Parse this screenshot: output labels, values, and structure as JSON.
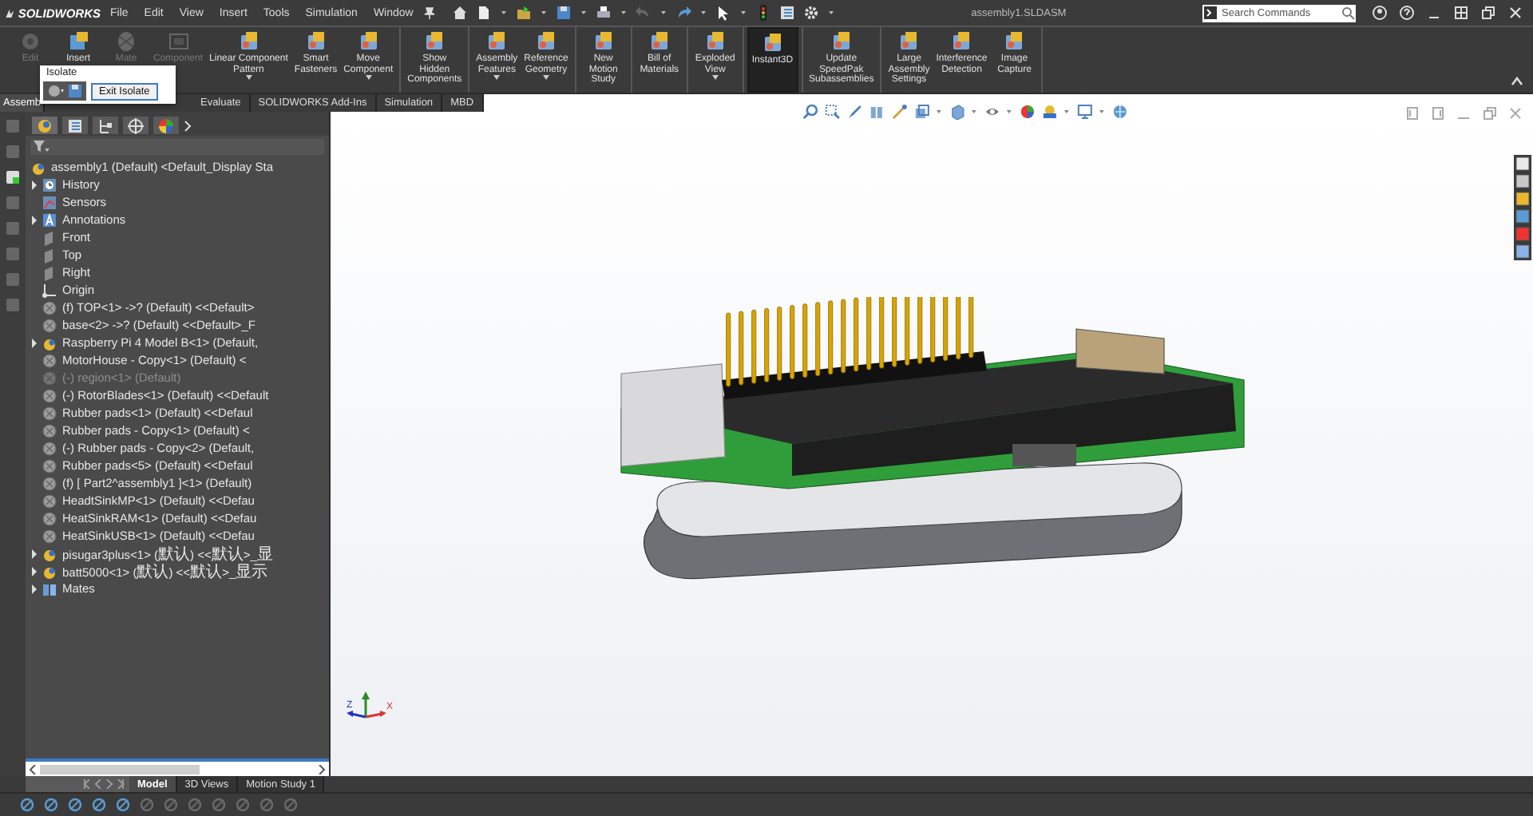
{
  "titlebar": {
    "brand": "SOLIDWORKS",
    "menus": [
      "File",
      "Edit",
      "View",
      "Insert",
      "Tools",
      "Simulation",
      "Window"
    ],
    "document_title": "assembly1.SLDASM",
    "search": {
      "placeholder": "Search Commands"
    }
  },
  "ribbon": {
    "groups": [
      [
        {
          "label": "Edit",
          "disabled": true,
          "on": false,
          "dropdown": false
        },
        {
          "label": "Insert",
          "disabled": false,
          "on": false,
          "dropdown": false
        },
        {
          "label": "Mate",
          "disabled": true,
          "on": false,
          "dropdown": false
        },
        {
          "label": "Component",
          "disabled": true,
          "on": false,
          "dropdown": false
        },
        {
          "label": "Linear Component\nPattern",
          "disabled": false,
          "on": false,
          "dropdown": true
        },
        {
          "label": "Smart\nFasteners",
          "disabled": false,
          "on": false,
          "dropdown": false
        },
        {
          "label": "Move\nComponent",
          "disabled": false,
          "on": false,
          "dropdown": true
        }
      ],
      [
        {
          "label": "Show\nHidden\nComponents",
          "disabled": false,
          "on": false,
          "dropdown": false
        }
      ],
      [
        {
          "label": "Assembly\nFeatures",
          "disabled": false,
          "on": false,
          "dropdown": true
        },
        {
          "label": "Reference\nGeometry",
          "disabled": false,
          "on": false,
          "dropdown": true
        }
      ],
      [
        {
          "label": "New\nMotion\nStudy",
          "disabled": false,
          "on": false,
          "dropdown": false
        }
      ],
      [
        {
          "label": "Bill of\nMaterials",
          "disabled": false,
          "on": false,
          "dropdown": false
        }
      ],
      [
        {
          "label": "Exploded\nView",
          "disabled": false,
          "on": false,
          "dropdown": true
        }
      ],
      [
        {
          "label": "Instant3D",
          "disabled": false,
          "on": true,
          "dropdown": false
        }
      ],
      [
        {
          "label": "Update\nSpeedPak\nSubassemblies",
          "disabled": false,
          "on": false,
          "dropdown": false
        }
      ],
      [
        {
          "label": "Large\nAssembly\nSettings",
          "disabled": false,
          "on": false,
          "dropdown": false
        },
        {
          "label": "Interference\nDetection",
          "disabled": false,
          "on": false,
          "dropdown": false
        },
        {
          "label": "Image\nCapture",
          "disabled": false,
          "on": false,
          "dropdown": false
        }
      ]
    ]
  },
  "tabs": [
    {
      "label": "Assemb",
      "selected": true
    },
    {
      "label": "Evaluate",
      "selected": false
    },
    {
      "label": "SOLIDWORKS Add-Ins",
      "selected": false
    },
    {
      "label": "Simulation",
      "selected": false
    },
    {
      "label": "MBD",
      "selected": false
    }
  ],
  "isolate_popup": {
    "title": "Isolate",
    "button": "Exit Isolate"
  },
  "tree": {
    "root": {
      "label": "assembly1 (Default) <Default_Display Sta",
      "kind": "assembly",
      "children": [
        {
          "label": "History",
          "kind": "history",
          "collapsed": true,
          "suppressed": false
        },
        {
          "label": "Sensors",
          "kind": "sensor",
          "collapsed": false,
          "suppressed": false
        },
        {
          "label": "Annotations",
          "kind": "annotation",
          "collapsed": true,
          "suppressed": false
        },
        {
          "label": "Front",
          "kind": "plane",
          "collapsed": false,
          "suppressed": false
        },
        {
          "label": "Top",
          "kind": "plane",
          "collapsed": false,
          "suppressed": false
        },
        {
          "label": "Right",
          "kind": "plane",
          "collapsed": false,
          "suppressed": false
        },
        {
          "label": "Origin",
          "kind": "origin",
          "collapsed": false,
          "suppressed": false
        },
        {
          "label": "(f) TOP<1> ->? (Default) <<Default>",
          "kind": "part",
          "collapsed": false,
          "suppressed": false
        },
        {
          "label": "base<2> ->? (Default) <<Default>_F",
          "kind": "part",
          "collapsed": false,
          "suppressed": false
        },
        {
          "label": "Raspberry Pi 4 Model B<1> (Default,",
          "kind": "assembly",
          "collapsed": true,
          "suppressed": false
        },
        {
          "label": "MotorHouse - Copy<1> (Default) <",
          "kind": "part",
          "collapsed": false,
          "suppressed": false
        },
        {
          "label": "(-) region<1> (Default)",
          "kind": "part",
          "collapsed": false,
          "suppressed": true
        },
        {
          "label": "(-) RotorBlades<1> (Default) <<Default",
          "kind": "part",
          "collapsed": false,
          "suppressed": false
        },
        {
          "label": "Rubber pads<1> (Default) <<Defaul",
          "kind": "part",
          "collapsed": false,
          "suppressed": false
        },
        {
          "label": "Rubber pads - Copy<1> (Default) <",
          "kind": "part",
          "collapsed": false,
          "suppressed": false
        },
        {
          "label": "(-) Rubber pads - Copy<2> (Default,",
          "kind": "part",
          "collapsed": false,
          "suppressed": false
        },
        {
          "label": "Rubber pads<5> (Default) <<Defaul",
          "kind": "part",
          "collapsed": false,
          "suppressed": false
        },
        {
          "label": "(f) [ Part2^assembly1 ]<1> (Default)",
          "kind": "part",
          "collapsed": false,
          "suppressed": false
        },
        {
          "label": "HeadtSinkMP<1> (Default) <<Defau",
          "kind": "part",
          "collapsed": false,
          "suppressed": false
        },
        {
          "label": "HeatSinkRAM<1> (Default) <<Defau",
          "kind": "part",
          "collapsed": false,
          "suppressed": false
        },
        {
          "label": "HeatSinkUSB<1> (Default) <<Defau",
          "kind": "part",
          "collapsed": false,
          "suppressed": false
        },
        {
          "label": "pisugar3plus<1> (默认) <<默认>_显",
          "kind": "assembly",
          "collapsed": true,
          "suppressed": false
        },
        {
          "label": "batt5000<1> (默认) <<默认>_显示",
          "kind": "assembly",
          "collapsed": true,
          "suppressed": false
        },
        {
          "label": "Mates",
          "kind": "mates",
          "collapsed": true,
          "suppressed": false
        }
      ]
    }
  },
  "triad": {
    "x_label": "X",
    "z_label": "Z"
  },
  "bottom_tabs": [
    {
      "label": "Model",
      "selected": true
    },
    {
      "label": "3D Views",
      "selected": false
    },
    {
      "label": "Motion Study 1",
      "selected": false
    }
  ]
}
